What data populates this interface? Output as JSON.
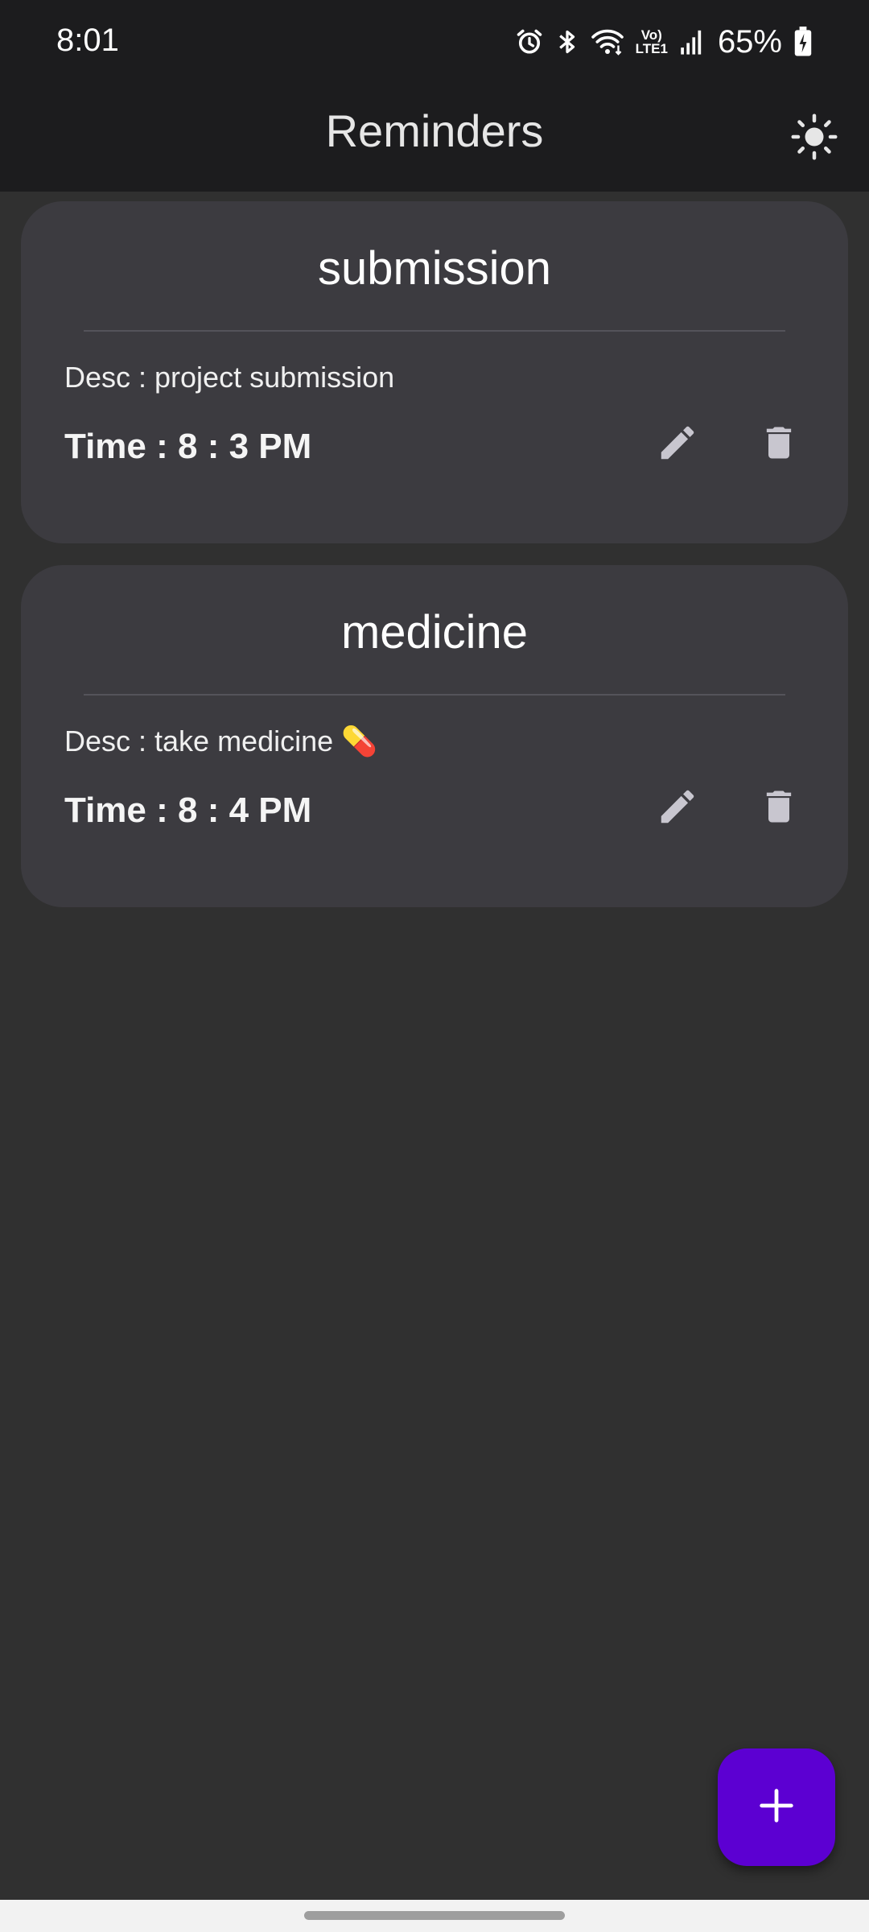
{
  "status_bar": {
    "time": "8:01",
    "battery": "65%",
    "icons": [
      "alarm-icon",
      "bluetooth-icon",
      "wifi-icon",
      "volte-icon",
      "signal-icon",
      "battery-charging-icon"
    ],
    "network_label_top": "Vo)",
    "network_label_bottom": "LTE1"
  },
  "app_bar": {
    "title": "Reminders",
    "theme_icon": "sun-icon"
  },
  "reminders": [
    {
      "title": "submission",
      "desc": "Desc : project submission",
      "time": "Time : 8 : 3  PM"
    },
    {
      "title": "medicine",
      "desc": "Desc : take medicine 💊",
      "time": "Time : 8 : 4  PM"
    }
  ],
  "colors": {
    "background": "#303030",
    "app_bar": "#1c1c1e",
    "card": "#3c3b40",
    "fab": "#5c00d2",
    "icon": "#c8c6cf"
  },
  "fab": {
    "icon": "plus-icon"
  }
}
